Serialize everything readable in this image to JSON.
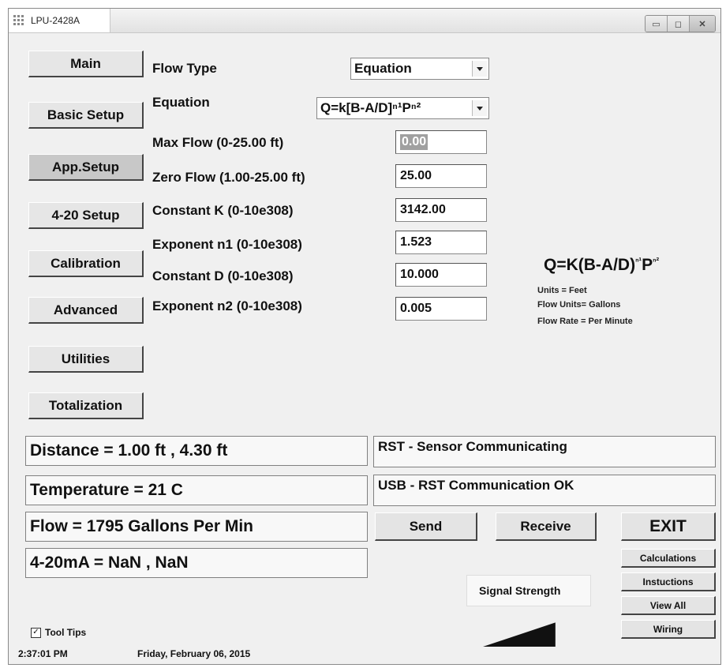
{
  "window": {
    "title": "LPU-2428A",
    "controls": {
      "minimize": "▭",
      "maximize": "◻",
      "close": "✕"
    }
  },
  "nav": [
    "Main",
    "Basic Setup",
    "App.Setup",
    "4-20 Setup",
    "Calibration",
    "Advanced",
    "Utilities",
    "Totalization"
  ],
  "form": {
    "flow_type_label": "Flow Type",
    "flow_type_value": "Equation",
    "equation_label": "Equation",
    "equation_value": "Q=k[B-A/D]ⁿ¹Pⁿ²",
    "fields": [
      {
        "label": "Max Flow (0-25.00 ft)",
        "value": "0.00"
      },
      {
        "label": "Zero Flow (1.00-25.00 ft)",
        "value": "25.00"
      },
      {
        "label": "Constant K (0-10e308)",
        "value": "3142.00"
      },
      {
        "label": "Exponent n1 (0-10e308)",
        "value": "1.523"
      },
      {
        "label": "Constant D (0-10e308)",
        "value": "10.000"
      },
      {
        "label": "Exponent n2 (0-10e308)",
        "value": "0.005"
      }
    ]
  },
  "formula": {
    "base": "Q=K(B-A/D)",
    "exp1": "n1",
    "mid": "P",
    "exp2": "n2",
    "units": "Units = Feet",
    "flow_units": "Flow Units= Gallons",
    "flow_rate": "Flow Rate = Per Minute"
  },
  "readings": {
    "distance": "Distance = 1.00 ft , 4.30 ft",
    "temperature": "Temperature = 21 C",
    "flow": "Flow = 1795 Gallons  Per Min",
    "current": "4-20mA = NaN , NaN"
  },
  "status": {
    "sensor": "RST - Sensor Communicating",
    "usb": "USB - RST Communication OK"
  },
  "buttons": {
    "send": "Send",
    "receive": "Receive",
    "exit": "EXIT",
    "calculations": "Calculations",
    "instructions": "Instuctions",
    "view_all": "View All",
    "wiring": "Wiring"
  },
  "signal": {
    "label": "Signal Strength",
    "level": 0.85
  },
  "footer": {
    "tooltips_label": "Tool Tips",
    "tooltips_checked": true,
    "time": "2:37:01 PM",
    "date": "Friday, February 06, 2015"
  }
}
